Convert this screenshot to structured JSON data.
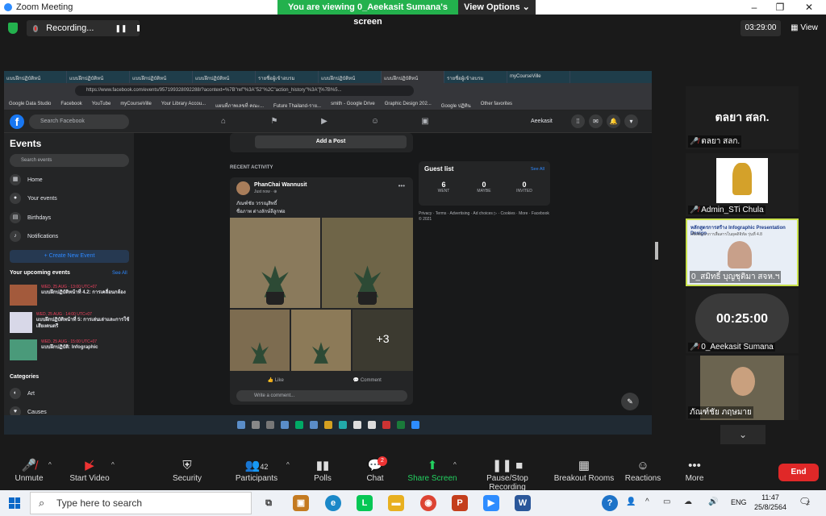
{
  "window": {
    "app_title": "Zoom Meeting",
    "banner": "You are viewing 0_Aeekasit Sumana's screen",
    "view_options": "View Options",
    "minimize": "–",
    "maximize": "❐",
    "close": "✕"
  },
  "meeting": {
    "recording_label": "Recording...",
    "timer": "03:29:00",
    "view_label": "View"
  },
  "browser": {
    "tabs": [
      "แบบฝึกปฏิบัติหน้",
      "แบบฝึกปฏิบัติหน้",
      "แบบฝึกปฏิบัติหน้",
      "แบบฝึกปฏิบัติหน้",
      "รายชื่อผู้เข้าอบรม",
      "แบบฝึกปฏิบัติหน้",
      "แบบฝึกปฏิบัติหน้",
      "รายชื่อผู้เข้าอบรม",
      "myCourseVille"
    ],
    "url": "https://www.facebook.com/events/957199328092288/?acontext=%7B\"ref\"%3A\"52\"%2C\"action_history\"%3A\"[%7B%5...",
    "bookmarks": [
      "Google Data Studio",
      "Facebook",
      "YouTube",
      "myCourseVille",
      "Your Library Accou...",
      "แผนที่ภาพเลขที่ คณะ...",
      "Future Thailand-ราย...",
      "smith - Google Drive",
      "Graphic Design 202...",
      "Google ปฏิทิน",
      "Other favorites"
    ]
  },
  "facebook": {
    "search_placeholder": "Search Facebook",
    "user": "Aeekasit",
    "badge_video": "9+",
    "badge_groups": "2",
    "sidebar": {
      "title": "Events",
      "search": "Search events",
      "items": [
        "Home",
        "Your events",
        "Birthdays",
        "Notifications"
      ],
      "create": "+ Create New Event",
      "upcoming_title": "Your upcoming events",
      "see_all": "See All",
      "upcoming": [
        {
          "date": "WED, 25 AUG · 13:00 UTC+07",
          "title": "แบบฝึกปฏิบัติหน้าที่ 4.2: การเคลื่อนกล้อง"
        },
        {
          "date": "WED, 25 AUG · 14:00 UTC+07",
          "title": "แบบฝึกปฏิบัติหน้าที่ 5: การเล่นเล่าและการใช้เสียงดนตรี"
        },
        {
          "date": "WED, 25 AUG · 15:00 UTC+07",
          "title": "แบบฝึกปฏิบัติ: Infographic"
        }
      ],
      "categories_title": "Categories",
      "categories": [
        "Art",
        "Causes"
      ]
    },
    "add_post": "Add a Post",
    "recent_activity": "RECENT ACTIVITY",
    "post": {
      "author": "PhanChai Wannusit",
      "time": "Just now · ⊕",
      "line1": "ภัณฑ์ชัย วรรณุสิทธิ์",
      "line2": "ชื่อภาพ ต่างลักษ์ลีลูกพ่อ",
      "more": "+3",
      "like": "Like",
      "comment": "Comment",
      "write_comment": "Write a comment..."
    },
    "guest": {
      "title": "Guest list",
      "see_all": "See All",
      "went": "6",
      "went_l": "WENT",
      "maybe": "0",
      "maybe_l": "MAYBE",
      "invited": "0",
      "invited_l": "INVITED"
    },
    "footer": "Privacy · Terms · Advertising · Ad choices ▷ · Cookies · More · Facebook © 2021"
  },
  "participants": [
    {
      "name": "ตลยา สลก.",
      "big": "ตลยา สลก."
    },
    {
      "name": "Admin_STi Chula"
    },
    {
      "name": "0_สมิทธิ์ บุญชุติมา สจห.ฯ",
      "slide_title": "หลักสูตรการสร้าง Infographic Presentation Design",
      "slide_sub": "เพื่อพัฒนาการสื่อสารในยุคดิจิทัล รุ่นที่ 4.8"
    },
    {
      "name": "0_Aeekasit Sumana",
      "timer": "00:25:00"
    },
    {
      "name": "ภัณฑ์ชัย ภฤษมาย"
    }
  ],
  "toolbar": {
    "mute": "Unmute",
    "video": "Start Video",
    "security": "Security",
    "participants": "Participants",
    "participants_count": "42",
    "polls": "Polls",
    "chat": "Chat",
    "chat_badge": "2",
    "share": "Share Screen",
    "record": "Pause/Stop Recording",
    "breakout": "Breakout Rooms",
    "reactions": "Reactions",
    "more": "More",
    "end": "End"
  },
  "taskbar": {
    "search": "Type here to search",
    "lang": "ENG",
    "time": "11:47",
    "date": "25/8/2564",
    "notif_count": "2"
  }
}
